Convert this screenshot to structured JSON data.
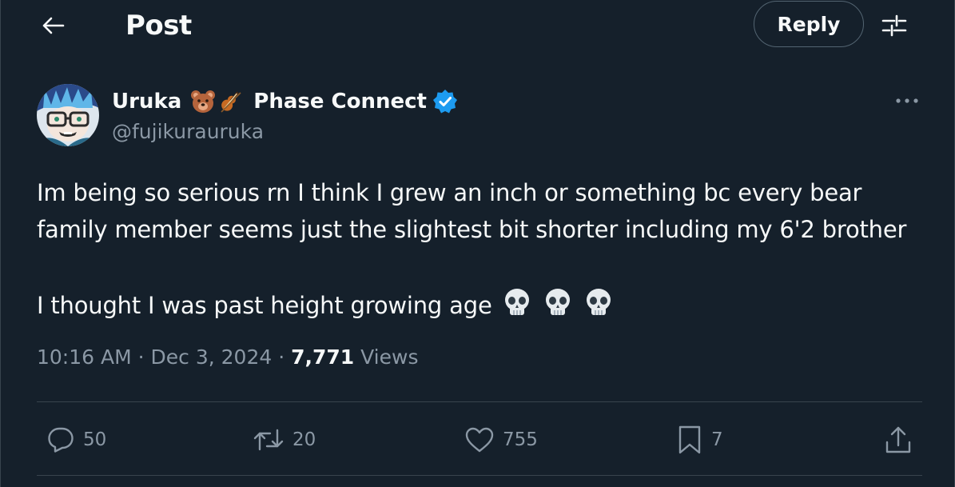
{
  "header": {
    "title": "Post",
    "reply_label": "Reply"
  },
  "author": {
    "display_name": "Uruka",
    "affiliation": "Phase Connect",
    "handle": "@fujikurauruka",
    "emojis": [
      "bear-emoji",
      "violin-emoji"
    ],
    "verified": true
  },
  "post": {
    "line1": "Im being so serious rn I think I grew an inch or something bc every bear",
    "line2": "family member seems just the slightest bit shorter including my 6'2 brother",
    "line3": "I thought I was past height growing age",
    "trailing_emojis": [
      "skull-emoji",
      "skull-emoji",
      "skull-emoji"
    ]
  },
  "meta": {
    "time": "10:16 AM",
    "separator": " · ",
    "date": "Dec 3, 2024",
    "views_count": "7,771",
    "views_label": " Views"
  },
  "actions": {
    "replies": "50",
    "reposts": "20",
    "likes": "755",
    "bookmarks": "7"
  },
  "colors": {
    "background": "#15202b",
    "text": "#f7f9f9",
    "muted": "#8b98a5",
    "border": "#38444d",
    "verified": "#1d9bf0"
  }
}
